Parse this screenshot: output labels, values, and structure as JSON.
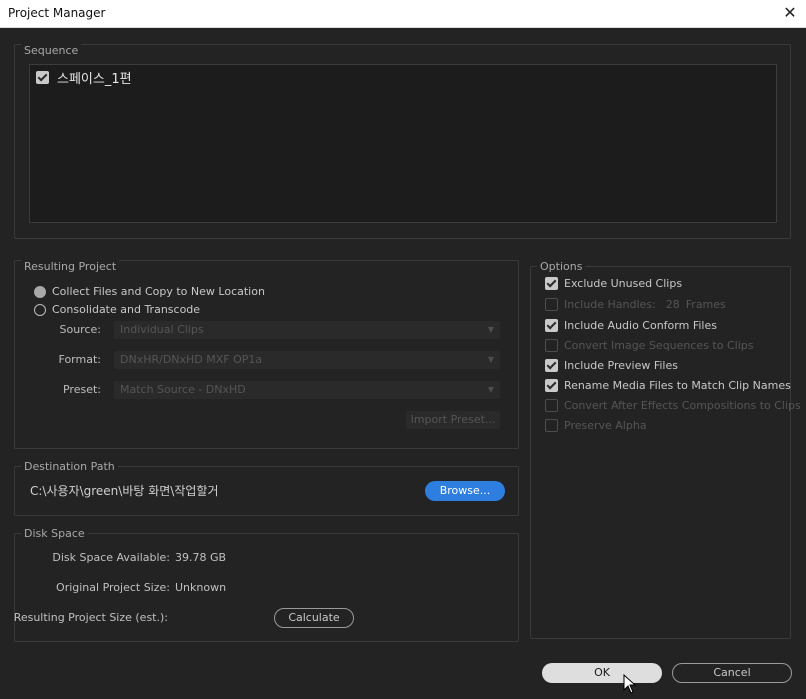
{
  "window": {
    "title": "Project Manager",
    "close_glyph": "✕"
  },
  "sequence": {
    "label": "Sequence",
    "items": [
      {
        "name": "스페이스_1편",
        "checked": true
      }
    ]
  },
  "resulting_project": {
    "label": "Resulting Project",
    "options": [
      {
        "label": "Collect Files and Copy to New Location",
        "selected": true
      },
      {
        "label": "Consolidate and Transcode",
        "selected": false
      }
    ],
    "source_label": "Source:",
    "source_value": "Individual Clips",
    "format_label": "Format:",
    "format_value": "DNxHR/DNxHD MXF OP1a",
    "preset_label": "Preset:",
    "preset_value": "Match Source - DNxHD",
    "import_preset_label": "Import Preset..."
  },
  "options": {
    "label": "Options",
    "items": [
      {
        "label": "Exclude Unused Clips",
        "checked": true,
        "enabled": true
      },
      {
        "label": "Include Handles:",
        "suffix_value": "28",
        "suffix_unit": "Frames",
        "checked": false,
        "enabled": false
      },
      {
        "label": "Include Audio Conform Files",
        "checked": true,
        "enabled": true
      },
      {
        "label": "Convert Image Sequences to Clips",
        "checked": false,
        "enabled": false
      },
      {
        "label": "Include Preview Files",
        "checked": true,
        "enabled": true
      },
      {
        "label": "Rename Media Files to Match Clip Names",
        "checked": true,
        "enabled": true
      },
      {
        "label": "Convert After Effects Compositions to Clips",
        "checked": false,
        "enabled": false
      },
      {
        "label": "Preserve Alpha",
        "checked": false,
        "enabled": false
      }
    ]
  },
  "destination": {
    "label": "Destination Path",
    "path": "C:\\사용자\\green\\바탕 화면\\작업할거",
    "browse_label": "Browse..."
  },
  "disk_space": {
    "label": "Disk Space",
    "available_label": "Disk Space Available:",
    "available_value": "39.78 GB",
    "original_label": "Original Project Size:",
    "original_value": "Unknown",
    "resulting_label": "Resulting Project Size (est.):",
    "calculate_label": "Calculate"
  },
  "footer": {
    "ok_label": "OK",
    "cancel_label": "Cancel"
  },
  "colors": {
    "accent": "#2e7ee0",
    "background": "#232323"
  }
}
